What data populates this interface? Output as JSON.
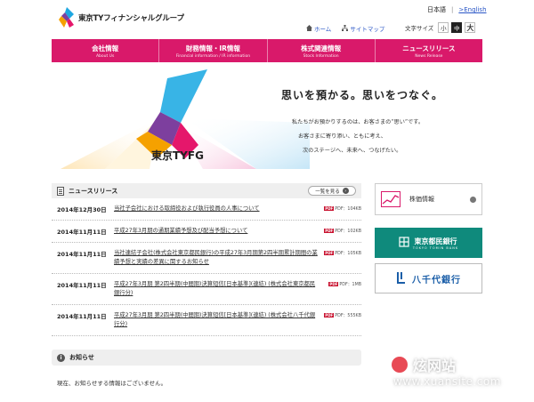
{
  "header": {
    "company_name": "東京TYフィナンシャルグループ",
    "lang_ja": "日本語",
    "lang_sep": "|",
    "lang_en": ">English",
    "home_label": "ホーム",
    "sitemap_label": "サイトマップ",
    "fontsize_label": "文字サイズ",
    "fontsize_small": "小",
    "fontsize_medium": "中",
    "fontsize_large": "大"
  },
  "nav": [
    {
      "ja": "会社情報",
      "en": "About Us"
    },
    {
      "ja": "財務情報・IR情報",
      "en": "Financial information / IR information"
    },
    {
      "ja": "株式関連情報",
      "en": "Stock Information"
    },
    {
      "ja": "ニュースリリース",
      "en": "News Release"
    }
  ],
  "hero": {
    "brand": "東京TYFG",
    "tagline": "思いを預かる。思いをつなぐ。",
    "body": [
      "私たちがお預かりするのは、お客さまの“思い”です。",
      "お客さまに寄り添い、ともに考え、",
      "次のステージへ、未来へ、つなげたい。"
    ]
  },
  "news": {
    "title": "ニュースリリース",
    "list_button": "一覧を見る",
    "items": [
      {
        "date": "2014年12月30日",
        "text": "当社子会社における取締役および執行役員の人事について",
        "pdf": "PDF：104KB"
      },
      {
        "date": "2014年11月11日",
        "text": "平成27年3月期の通期業績予想及び配当予想について",
        "pdf": "PDF：102KB"
      },
      {
        "date": "2014年11月11日",
        "text": "当社連結子会社(株式会社東京都民銀行)の平成27年3月期第2四半期累計期間の業績予想と実績の差異に関するお知らせ",
        "pdf": "PDF：105KB"
      },
      {
        "date": "2014年11月11日",
        "text": "平成27年3月期 第2四半期(中間期)決算短信[日本基準](連結) (株式会社東京都民銀行分)",
        "pdf": "PDF：1MB"
      },
      {
        "date": "2014年11月11日",
        "text": "平成27年3月期 第2四半期(中間期)決算短信[日本基準](連結) (株式会社八千代銀行分)",
        "pdf": "PDF：555KB"
      }
    ]
  },
  "notice": {
    "title": "お知らせ",
    "text": "現在、お知らせする情報はございません。"
  },
  "sidebar": {
    "stock_label": "株価情報",
    "bank1_name": "東京都民銀行",
    "bank1_en": "TOKYO TOMIN BANK",
    "bank2_name": "八千代銀行"
  },
  "watermark": {
    "cn": "炫网站",
    "url": "www.xuansite.com"
  },
  "colors": {
    "nav_bg": "#d9196a",
    "bank1_bg": "#0f8a7c",
    "bank2_text": "#1a5ea8"
  }
}
